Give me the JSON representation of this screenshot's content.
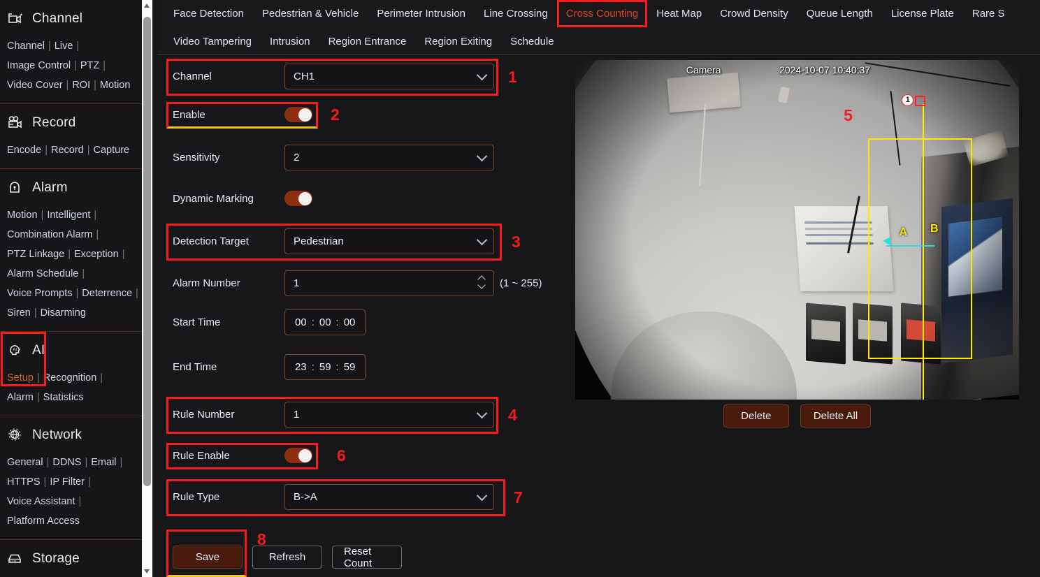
{
  "sidebar": {
    "groups": [
      {
        "icon": "camera-icon",
        "title": "Channel",
        "rows": [
          [
            {
              "label": "Channel",
              "active": false
            },
            {
              "label": "Live",
              "active": false
            }
          ],
          [
            {
              "label": "Image Control",
              "active": false
            },
            {
              "label": "PTZ",
              "active": false
            }
          ],
          [
            {
              "label": "Video Cover",
              "active": false
            },
            {
              "label": "ROI",
              "active": false
            },
            {
              "label": "Motion",
              "active": false,
              "last": true
            }
          ]
        ]
      },
      {
        "icon": "record-icon",
        "title": "Record",
        "rows": [
          [
            {
              "label": "Encode",
              "active": false
            },
            {
              "label": "Record",
              "active": false
            },
            {
              "label": "Capture",
              "active": false,
              "last": true
            }
          ]
        ]
      },
      {
        "icon": "alarm-icon",
        "title": "Alarm",
        "rows": [
          [
            {
              "label": "Motion",
              "active": false
            },
            {
              "label": "Intelligent",
              "active": false
            }
          ],
          [
            {
              "label": "Combination Alarm",
              "active": false
            }
          ],
          [
            {
              "label": "PTZ Linkage",
              "active": false
            },
            {
              "label": "Exception",
              "active": false
            }
          ],
          [
            {
              "label": "Alarm Schedule",
              "active": false
            }
          ],
          [
            {
              "label": "Voice Prompts",
              "active": false
            },
            {
              "label": "Deterrence",
              "active": false
            }
          ],
          [
            {
              "label": "Siren",
              "active": false
            },
            {
              "label": "Disarming",
              "active": false,
              "last": true
            }
          ]
        ]
      },
      {
        "icon": "ai-icon",
        "title": "AI",
        "highlighted": true,
        "rows": [
          [
            {
              "label": "Setup",
              "active": true
            },
            {
              "label": "Recognition",
              "active": false
            }
          ],
          [
            {
              "label": "Alarm",
              "active": false
            },
            {
              "label": "Statistics",
              "active": false,
              "last": true
            }
          ]
        ]
      },
      {
        "icon": "network-icon",
        "title": "Network",
        "rows": [
          [
            {
              "label": "General",
              "active": false
            },
            {
              "label": "DDNS",
              "active": false
            },
            {
              "label": "Email",
              "active": false
            }
          ],
          [
            {
              "label": "HTTPS",
              "active": false
            },
            {
              "label": "IP Filter",
              "active": false
            }
          ],
          [
            {
              "label": "Voice Assistant",
              "active": false
            }
          ],
          [
            {
              "label": "Platform Access",
              "active": false,
              "last": true
            }
          ]
        ]
      },
      {
        "icon": "storage-icon",
        "title": "Storage",
        "rows": []
      }
    ]
  },
  "tabs": {
    "row1": [
      {
        "label": "Face Detection",
        "selected": false
      },
      {
        "label": "Pedestrian & Vehicle",
        "selected": false
      },
      {
        "label": "Perimeter Intrusion",
        "selected": false
      },
      {
        "label": "Line Crossing",
        "selected": false
      },
      {
        "label": "Cross Counting",
        "selected": true
      },
      {
        "label": "Heat Map",
        "selected": false
      },
      {
        "label": "Crowd Density",
        "selected": false
      },
      {
        "label": "Queue Length",
        "selected": false
      },
      {
        "label": "License Plate",
        "selected": false
      },
      {
        "label": "Rare S",
        "selected": false
      }
    ],
    "row2": [
      {
        "label": "Video Tampering",
        "selected": false
      },
      {
        "label": "Intrusion",
        "selected": false
      },
      {
        "label": "Region Entrance",
        "selected": false
      },
      {
        "label": "Region Exiting",
        "selected": false
      },
      {
        "label": "Schedule",
        "selected": false
      }
    ]
  },
  "form": {
    "channel": {
      "label": "Channel",
      "value": "CH1"
    },
    "enable": {
      "label": "Enable",
      "value": "on"
    },
    "sensitivity": {
      "label": "Sensitivity",
      "value": "2"
    },
    "dynamic_marking": {
      "label": "Dynamic Marking",
      "value": "on"
    },
    "detection_target": {
      "label": "Detection Target",
      "value": "Pedestrian"
    },
    "alarm_number": {
      "label": "Alarm Number",
      "value": "1",
      "hint": "(1 ~ 255)"
    },
    "start_time": {
      "label": "Start Time",
      "h": "00",
      "m": "00",
      "s": "00",
      "sep": ":"
    },
    "end_time": {
      "label": "End Time",
      "h": "23",
      "m": "59",
      "s": "59",
      "sep": ":"
    },
    "rule_number": {
      "label": "Rule Number",
      "value": "1"
    },
    "rule_enable": {
      "label": "Rule Enable",
      "value": "on"
    },
    "rule_type": {
      "label": "Rule Type",
      "value": "B->A"
    },
    "buttons": {
      "save": "Save",
      "refresh": "Refresh",
      "reset_count": "Reset Count"
    }
  },
  "annotations": {
    "n1": "1",
    "n2": "2",
    "n3": "3",
    "n4": "4",
    "n5": "5",
    "n6": "6",
    "n7": "7",
    "n8": "8"
  },
  "video": {
    "osd_name": "Camera",
    "osd_time": "2024-10-07 10:40:37",
    "rule_badge": "1",
    "label_a": "A",
    "label_b": "B",
    "buttons": {
      "delete": "Delete",
      "delete_all": "Delete All"
    }
  },
  "colors": {
    "accent_red": "#ef1d1d",
    "accent_orange": "#d4622a",
    "toggle_on": "#8c2e10",
    "rule_yellow": "#ffe800",
    "arrow_cyan": "#27e1e1",
    "button_primary": "#4a1b0c"
  }
}
